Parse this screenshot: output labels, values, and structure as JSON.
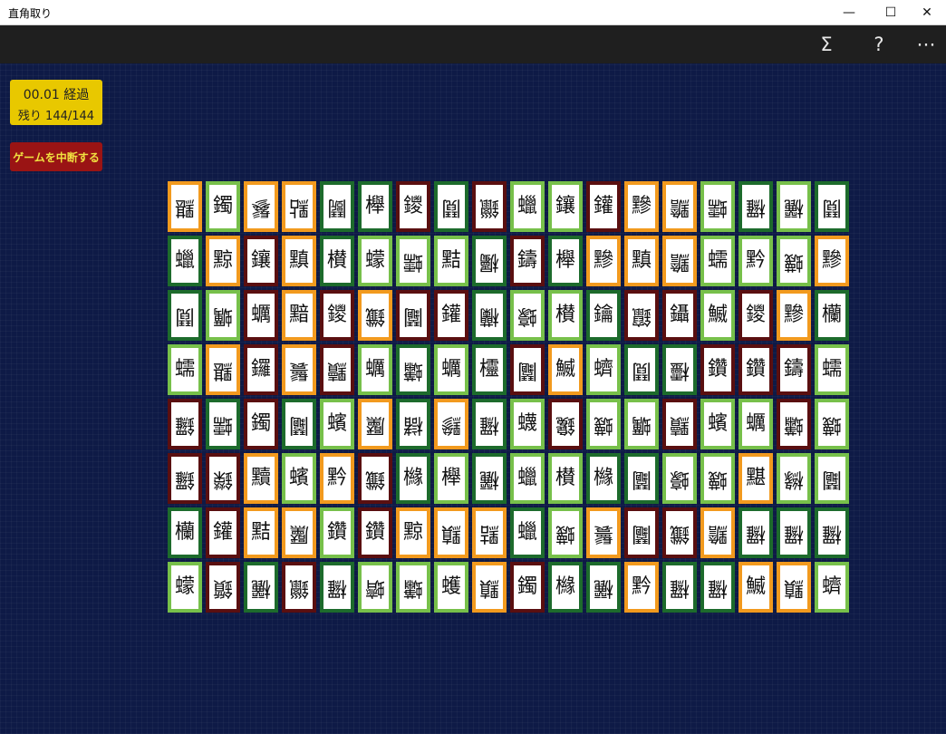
{
  "window": {
    "title": "直角取り",
    "minimize_glyph": "—",
    "maximize_glyph": "☐",
    "close_glyph": "✕"
  },
  "commandbar": {
    "stats_icon": "Σ",
    "help_icon": "?",
    "more_icon": "⋯"
  },
  "status": {
    "elapsed": "00.01 経過",
    "remaining": "残り 144/144"
  },
  "abort_button": "ゲームを中断する",
  "colors": {
    "dark_green": "#1d6b2c",
    "light_green": "#77c04a",
    "orange": "#f29a1e",
    "maroon": "#5a0f10",
    "status_yellow": "#e8c800",
    "abort_red": "#9a1414",
    "background": "#0e1a46"
  },
  "board": {
    "rows": [
      [
        "黮",
        "鐲",
        "鬖",
        "點",
        "鬭",
        "櫸",
        "鑁",
        "鬩",
        "鑞",
        "蠟",
        "鑲",
        "鑵",
        "黲",
        "黵",
        "蠕",
        "欏",
        "欐",
        "鬩"
      ],
      [
        "蠟",
        "黥",
        "鑲",
        "黰",
        "櫕",
        "蠓",
        "蠕",
        "黠",
        "欘",
        "鑄",
        "櫸",
        "黲",
        "黰",
        "黵",
        "蠕",
        "黔",
        "蠛",
        "黲"
      ],
      [
        "鬩",
        "蠣",
        "蠣",
        "黯",
        "鑁",
        "鑯",
        "鬮",
        "鑵",
        "欗",
        "蠔",
        "櫕",
        "鑰",
        "鑹",
        "鑷",
        "鰄",
        "鑁",
        "黲",
        "欗"
      ],
      [
        "蠕",
        "黮",
        "鑼",
        "鬟",
        "黷",
        "蠣",
        "蠨",
        "蠣",
        "欞",
        "鬮",
        "鰄",
        "蠐",
        "鬩",
        "欞",
        "鑽",
        "鑽",
        "鑄",
        "蠕"
      ],
      [
        "鑼",
        "蠕",
        "鐲",
        "鬮",
        "蠙",
        "黶",
        "櫧",
        "黲",
        "欏",
        "蠛",
        "鑱",
        "蠛",
        "蠣",
        "黷",
        "蠙",
        "蠣",
        "蠨",
        "蠛"
      ],
      [
        "鑼",
        "鑅",
        "黷",
        "蠙",
        "黔",
        "鑯",
        "櫞",
        "櫸",
        "欐",
        "蠟",
        "櫕",
        "櫞",
        "鬮",
        "蠔",
        "蠛",
        "黮",
        "櫞",
        "鬮"
      ],
      [
        "欗",
        "鑵",
        "黠",
        "黶",
        "鑽",
        "鑽",
        "黥",
        "黰",
        "黠",
        "蠟",
        "蠛",
        "鬟",
        "鬮",
        "鑯",
        "黵",
        "欏",
        "欏",
        "欏"
      ],
      [
        "蠓",
        "鑕",
        "欐",
        "鑞",
        "欏",
        "蠐",
        "蠨",
        "蠖",
        "黰",
        "鐲",
        "櫞",
        "欐",
        "黔",
        "欏",
        "欏",
        "鰄",
        "黰",
        "蠐"
      ]
    ],
    "colors": [
      [
        2,
        1,
        2,
        2,
        0,
        0,
        3,
        0,
        3,
        1,
        1,
        3,
        2,
        2,
        1,
        0,
        1,
        0
      ],
      [
        0,
        2,
        3,
        2,
        0,
        1,
        1,
        1,
        0,
        3,
        0,
        2,
        2,
        2,
        1,
        1,
        1,
        2
      ],
      [
        0,
        1,
        3,
        2,
        3,
        2,
        3,
        3,
        0,
        1,
        1,
        0,
        3,
        3,
        1,
        3,
        2,
        0
      ],
      [
        1,
        2,
        3,
        2,
        3,
        1,
        0,
        1,
        0,
        3,
        2,
        1,
        0,
        0,
        3,
        3,
        3,
        1
      ],
      [
        3,
        0,
        3,
        0,
        1,
        2,
        0,
        2,
        0,
        1,
        3,
        1,
        1,
        3,
        1,
        1,
        3,
        1
      ],
      [
        3,
        3,
        2,
        1,
        2,
        3,
        0,
        1,
        0,
        1,
        1,
        0,
        0,
        1,
        1,
        2,
        1,
        1
      ],
      [
        0,
        3,
        2,
        2,
        1,
        3,
        2,
        2,
        2,
        0,
        1,
        2,
        3,
        3,
        2,
        0,
        0,
        0
      ],
      [
        1,
        3,
        0,
        3,
        0,
        1,
        1,
        1,
        2,
        3,
        0,
        0,
        2,
        0,
        0,
        2,
        2,
        1
      ]
    ],
    "flipped": [
      [
        1,
        0,
        1,
        1,
        1,
        0,
        0,
        1,
        1,
        0,
        0,
        0,
        0,
        1,
        1,
        1,
        1,
        1
      ],
      [
        0,
        0,
        0,
        0,
        0,
        0,
        1,
        0,
        1,
        0,
        0,
        0,
        0,
        1,
        0,
        0,
        1,
        0
      ],
      [
        1,
        1,
        0,
        0,
        0,
        1,
        1,
        0,
        1,
        1,
        0,
        0,
        1,
        0,
        0,
        0,
        0,
        0
      ],
      [
        0,
        1,
        0,
        1,
        1,
        0,
        1,
        0,
        0,
        1,
        0,
        0,
        1,
        1,
        0,
        0,
        0,
        0
      ],
      [
        1,
        1,
        0,
        1,
        0,
        1,
        1,
        1,
        1,
        0,
        1,
        1,
        1,
        1,
        0,
        0,
        1,
        1
      ],
      [
        1,
        1,
        0,
        0,
        0,
        1,
        0,
        0,
        1,
        0,
        0,
        0,
        1,
        1,
        1,
        0,
        1,
        1
      ],
      [
        0,
        0,
        0,
        1,
        0,
        0,
        0,
        1,
        1,
        0,
        1,
        1,
        1,
        1,
        1,
        1,
        1,
        1
      ],
      [
        0,
        1,
        1,
        1,
        1,
        1,
        1,
        0,
        1,
        0,
        0,
        1,
        0,
        1,
        1,
        0,
        1,
        0
      ]
    ]
  }
}
